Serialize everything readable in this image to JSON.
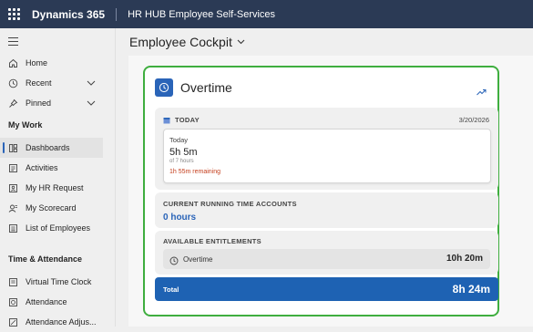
{
  "topbar": {
    "app_name": "Dynamics 365",
    "app_subtitle": "HR HUB Employee Self-Services"
  },
  "sidebar": {
    "items_top": [
      {
        "label": "Home",
        "icon": "home-icon"
      },
      {
        "label": "Recent",
        "icon": "clock-icon",
        "expandable": true
      },
      {
        "label": "Pinned",
        "icon": "pin-icon",
        "expandable": true
      }
    ],
    "section_my_work": "My Work",
    "items_my_work": [
      {
        "label": "Dashboards",
        "icon": "dashboard-icon",
        "active": true
      },
      {
        "label": "Activities",
        "icon": "activities-icon"
      },
      {
        "label": "My HR Request",
        "icon": "request-icon"
      },
      {
        "label": "My Scorecard",
        "icon": "scorecard-icon"
      },
      {
        "label": "List of Employees",
        "icon": "people-icon"
      }
    ],
    "section_time": "Time & Attendance",
    "items_time": [
      {
        "label": "Virtual Time Clock",
        "icon": "time-clock-icon"
      },
      {
        "label": "Attendance",
        "icon": "attendance-icon"
      },
      {
        "label": "Attendance Adjus...",
        "icon": "attendance-adjust-icon"
      }
    ]
  },
  "page": {
    "title": "Employee Cockpit"
  },
  "card": {
    "title": "Overtime",
    "today": {
      "header": "TODAY",
      "date": "3/20/2026",
      "label": "Today",
      "value": "5h 5m",
      "of_hours": "of 7 hours",
      "remaining": "1h 55m remaining"
    },
    "running": {
      "header": "CURRENT RUNNING TIME ACCOUNTS",
      "value": "0 hours"
    },
    "entitlements": {
      "header": "AVAILABLE ENTITLEMENTS",
      "rows": [
        {
          "name": "Overtime",
          "value": "10h 20m"
        }
      ]
    },
    "total": {
      "label": "Total",
      "value": "8h 24m"
    }
  },
  "colors": {
    "topbar": "#2b3a55",
    "accent_blue": "#2a64b8",
    "card_border": "#3fae3f",
    "remaining_text": "#c43e1c",
    "total_bar": "#1e62b3"
  }
}
